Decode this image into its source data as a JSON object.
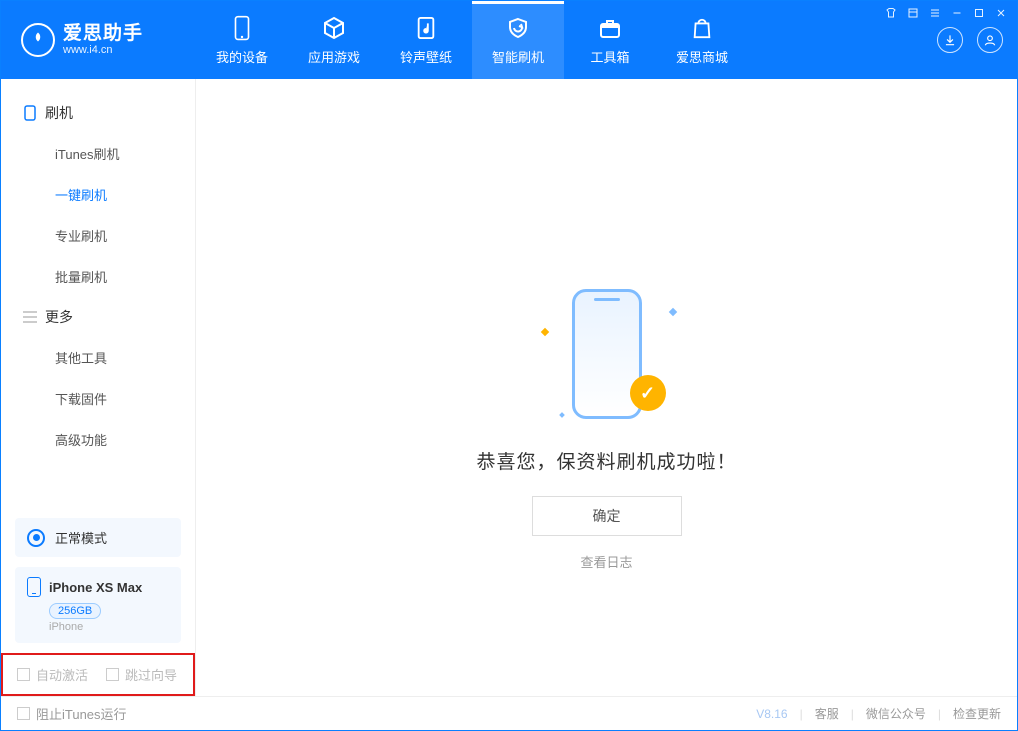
{
  "brand": {
    "name": "爱思助手",
    "url": "www.i4.cn"
  },
  "nav": {
    "items": [
      {
        "label": "我的设备"
      },
      {
        "label": "应用游戏"
      },
      {
        "label": "铃声壁纸"
      },
      {
        "label": "智能刷机"
      },
      {
        "label": "工具箱"
      },
      {
        "label": "爱思商城"
      }
    ]
  },
  "sidebar": {
    "sections": [
      {
        "title": "刷机",
        "items": [
          {
            "label": "iTunes刷机"
          },
          {
            "label": "一键刷机"
          },
          {
            "label": "专业刷机"
          },
          {
            "label": "批量刷机"
          }
        ]
      },
      {
        "title": "更多",
        "items": [
          {
            "label": "其他工具"
          },
          {
            "label": "下载固件"
          },
          {
            "label": "高级功能"
          }
        ]
      }
    ],
    "mode_label": "正常模式",
    "device": {
      "name": "iPhone XS Max",
      "capacity": "256GB",
      "sub": "iPhone"
    },
    "checkboxes": {
      "auto_activate": "自动激活",
      "skip_guide": "跳过向导"
    }
  },
  "main": {
    "success_message": "恭喜您，保资料刷机成功啦！",
    "ok_button": "确定",
    "view_log": "查看日志"
  },
  "footer": {
    "block_itunes": "阻止iTunes运行",
    "version": "V8.16",
    "links": {
      "support": "客服",
      "wechat": "微信公众号",
      "check_update": "检查更新"
    }
  }
}
